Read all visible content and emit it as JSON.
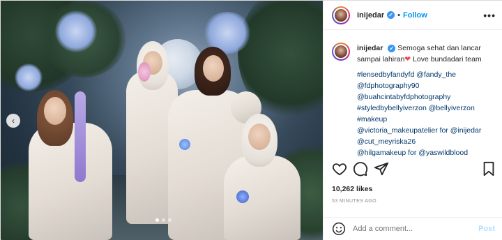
{
  "header": {
    "username": "inijedar",
    "separator": "•",
    "follow_label": "Follow",
    "more_label": "•••"
  },
  "caption": {
    "username": "inijedar",
    "text_before": "Semoga sehat dan lancar sampai lahiran",
    "heart": "❤",
    "text_after": " Love bundadari team",
    "tags": [
      "#lensedbyfandyfd @fandy_the",
      "@fdphotography90",
      "@buahcintabyfdphotography",
      "#styledbybellyiverzon @bellyiverzon",
      "#makeup",
      "@victoria_makeupatelier for @inijedar",
      "@cut_meyriska26",
      "@hilgamakeup for @yaswildblood"
    ]
  },
  "stats": {
    "likes": "10,262 likes",
    "time": "53 MINUTES AGO"
  },
  "comment": {
    "placeholder": "Add a comment...",
    "post_label": "Post"
  },
  "photo": {
    "nav_arrow": "‹",
    "dots": 3,
    "active_dot": 0
  },
  "colors": {
    "accent": "#0095f6",
    "link": "#00376b",
    "verified": "#3897f0",
    "muted": "#8e8e8e",
    "heart": "#ed4956"
  },
  "icons": [
    "verified-badge-icon",
    "more-icon",
    "heart-icon",
    "comment-icon",
    "share-icon",
    "bookmark-icon",
    "emoji-icon",
    "chevron-left-icon"
  ]
}
